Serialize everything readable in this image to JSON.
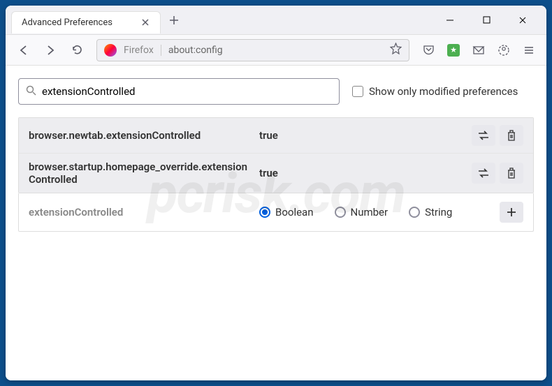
{
  "tab": {
    "title": "Advanced Preferences"
  },
  "urlbar": {
    "identity": "Firefox",
    "url": "about:config"
  },
  "search": {
    "value": "extensionControlled",
    "checkbox_label": "Show only modified preferences"
  },
  "prefs": [
    {
      "name": "browser.newtab.extensionControlled",
      "value": "true"
    },
    {
      "name": "browser.startup.homepage_override.extensionControlled",
      "value": "true"
    }
  ],
  "add": {
    "name": "extensionControlled",
    "type_boolean": "Boolean",
    "type_number": "Number",
    "type_string": "String"
  }
}
